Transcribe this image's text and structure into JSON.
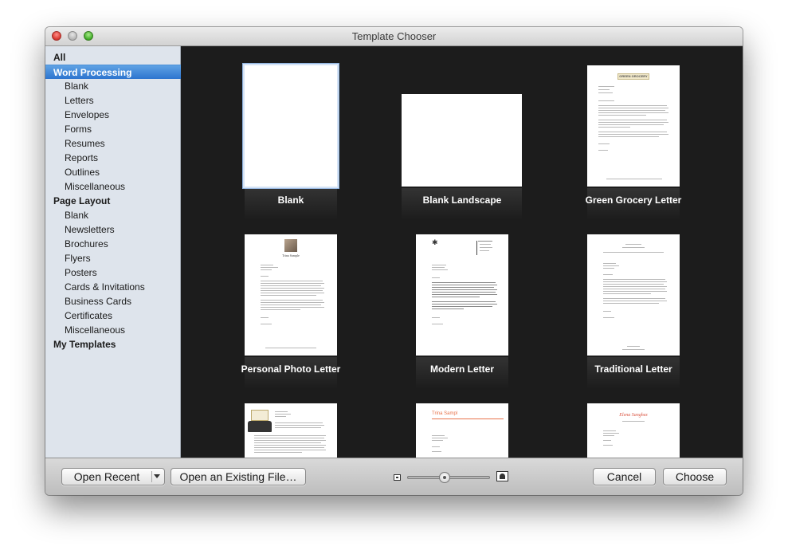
{
  "window": {
    "title": "Template Chooser"
  },
  "sidebar": {
    "items": [
      {
        "label": "All",
        "level": "group",
        "selected": false
      },
      {
        "label": "Word Processing",
        "level": "group",
        "selected": true
      },
      {
        "label": "Blank",
        "level": "sub",
        "selected": false
      },
      {
        "label": "Letters",
        "level": "sub",
        "selected": false
      },
      {
        "label": "Envelopes",
        "level": "sub",
        "selected": false
      },
      {
        "label": "Forms",
        "level": "sub",
        "selected": false
      },
      {
        "label": "Resumes",
        "level": "sub",
        "selected": false
      },
      {
        "label": "Reports",
        "level": "sub",
        "selected": false
      },
      {
        "label": "Outlines",
        "level": "sub",
        "selected": false
      },
      {
        "label": "Miscellaneous",
        "level": "sub",
        "selected": false
      },
      {
        "label": "Page Layout",
        "level": "group",
        "selected": false
      },
      {
        "label": "Blank",
        "level": "sub",
        "selected": false
      },
      {
        "label": "Newsletters",
        "level": "sub",
        "selected": false
      },
      {
        "label": "Brochures",
        "level": "sub",
        "selected": false
      },
      {
        "label": "Flyers",
        "level": "sub",
        "selected": false
      },
      {
        "label": "Posters",
        "level": "sub",
        "selected": false
      },
      {
        "label": "Cards & Invitations",
        "level": "sub",
        "selected": false
      },
      {
        "label": "Business Cards",
        "level": "sub",
        "selected": false
      },
      {
        "label": "Certificates",
        "level": "sub",
        "selected": false
      },
      {
        "label": "Miscellaneous",
        "level": "sub",
        "selected": false
      },
      {
        "label": "My Templates",
        "level": "group",
        "selected": false
      }
    ]
  },
  "templates": [
    {
      "label": "Blank",
      "selected": true
    },
    {
      "label": "Blank Landscape",
      "selected": false
    },
    {
      "label": "Green Grocery Letter",
      "selected": false
    },
    {
      "label": "Personal Photo Letter",
      "selected": false
    },
    {
      "label": "Modern Letter",
      "selected": false
    },
    {
      "label": "Traditional Letter",
      "selected": false
    },
    {
      "label": "",
      "selected": false
    },
    {
      "label": "",
      "selected": false
    },
    {
      "label": "",
      "selected": false
    }
  ],
  "thumbnail_text": {
    "green_grocery_banner": "GREEN GROCERY",
    "personal_photo_name": "Trina Sample",
    "script_name": "Elena Sanghez",
    "orange_name": "Trina Sampl"
  },
  "toolbar": {
    "open_recent_label": "Open Recent",
    "open_existing_label": "Open an Existing File…",
    "cancel_label": "Cancel",
    "choose_label": "Choose",
    "thumbnail_size": 0.45
  },
  "colors": {
    "selection": "#2c74cf",
    "sidebar_bg": "#dee4ec",
    "content_bg": "#1c1c1c",
    "orange_accent": "#e8734a"
  }
}
